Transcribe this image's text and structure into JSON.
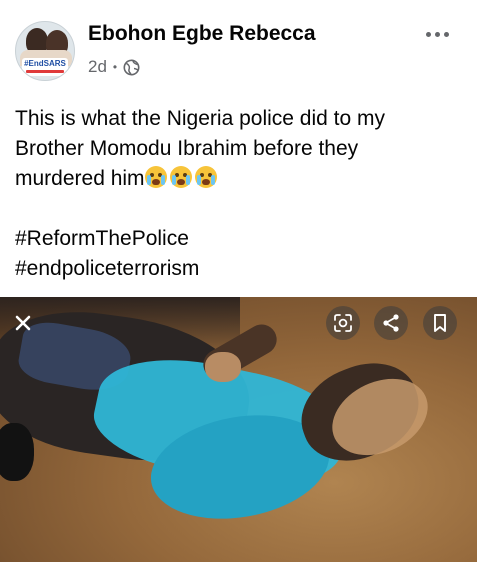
{
  "post": {
    "author": "Ebohon Egbe Rebecca",
    "timestamp": "2d",
    "separator": "•",
    "visibility_icon": "globe-icon",
    "more_icon": "more-options-icon",
    "avatar": {
      "badge_text": "#EndSARS"
    },
    "text_lines": [
      "This is what the Nigeria police did to my",
      "Brother Momodu Ibrahim before they",
      "murdered him"
    ],
    "emojis": [
      "loudly-crying-face",
      "loudly-crying-face",
      "loudly-crying-face"
    ],
    "hashtags": [
      "#ReformThePolice",
      "#endpoliceterrorism"
    ]
  },
  "photo_viewer": {
    "controls": [
      "close-icon",
      "lens-icon",
      "share-icon",
      "bookmark-icon"
    ]
  },
  "colors": {
    "text": "#050505",
    "secondary": "#65676b",
    "control_bg": "#3c3c3c"
  }
}
